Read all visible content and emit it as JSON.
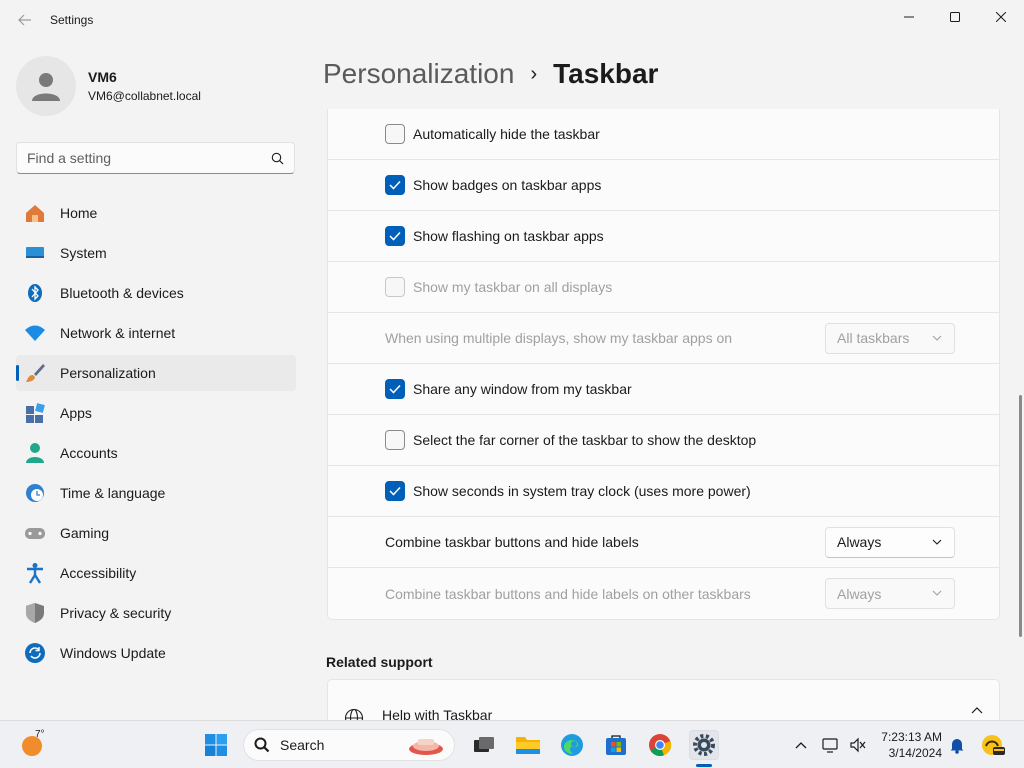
{
  "window": {
    "title": "Settings"
  },
  "profile": {
    "name": "VM6",
    "email": "VM6@collabnet.local"
  },
  "search": {
    "placeholder": "Find a setting"
  },
  "nav": {
    "items": [
      {
        "label": "Home",
        "icon": "home-icon",
        "color": "#e07a3a"
      },
      {
        "label": "System",
        "icon": "system-icon",
        "color": "#0078d4"
      },
      {
        "label": "Bluetooth & devices",
        "icon": "bluetooth-icon",
        "color": "#0078d4"
      },
      {
        "label": "Network & internet",
        "icon": "wifi-icon",
        "color": "#0078d4"
      },
      {
        "label": "Personalization",
        "icon": "brush-icon",
        "color": "#e08a3a"
      },
      {
        "label": "Apps",
        "icon": "apps-icon",
        "color": "#4a6fa5"
      },
      {
        "label": "Accounts",
        "icon": "accounts-icon",
        "color": "#1fa88a"
      },
      {
        "label": "Time & language",
        "icon": "time-language-icon",
        "color": "#2f80d1"
      },
      {
        "label": "Gaming",
        "icon": "gaming-icon",
        "color": "#8a8a8a"
      },
      {
        "label": "Accessibility",
        "icon": "accessibility-icon",
        "color": "#1a73c8"
      },
      {
        "label": "Privacy & security",
        "icon": "shield-icon",
        "color": "#7a7a7a"
      },
      {
        "label": "Windows Update",
        "icon": "update-icon",
        "color": "#0f6cbd"
      }
    ],
    "active": "Personalization"
  },
  "breadcrumb": {
    "parent": "Personalization",
    "separator": "›",
    "current": "Taskbar"
  },
  "settings": {
    "auto_hide": {
      "label": "Automatically hide the taskbar",
      "checked": false
    },
    "badges": {
      "label": "Show badges on taskbar apps",
      "checked": true
    },
    "flashing": {
      "label": "Show flashing on taskbar apps",
      "checked": true
    },
    "all_displays": {
      "label": "Show my taskbar on all displays",
      "checked": false,
      "disabled": true
    },
    "multi_display": {
      "label": "When using multiple displays, show my taskbar apps on",
      "value": "All taskbars",
      "disabled": true
    },
    "share_window": {
      "label": "Share any window from my taskbar",
      "checked": true
    },
    "far_corner": {
      "label": "Select the far corner of the taskbar to show the desktop",
      "checked": false
    },
    "seconds": {
      "label": "Show seconds in system tray clock (uses more power)",
      "checked": true
    },
    "combine": {
      "label": "Combine taskbar buttons and hide labels",
      "value": "Always"
    },
    "combine_other": {
      "label": "Combine taskbar buttons and hide labels on other taskbars",
      "value": "Always",
      "disabled": true
    }
  },
  "related": {
    "heading": "Related support",
    "help_label": "Help with Taskbar"
  },
  "taskbar": {
    "weather_temp": "7°",
    "search_label": "Search",
    "time": "7:23:13 AM",
    "date": "3/14/2024"
  },
  "colors": {
    "accent": "#005fb8"
  }
}
